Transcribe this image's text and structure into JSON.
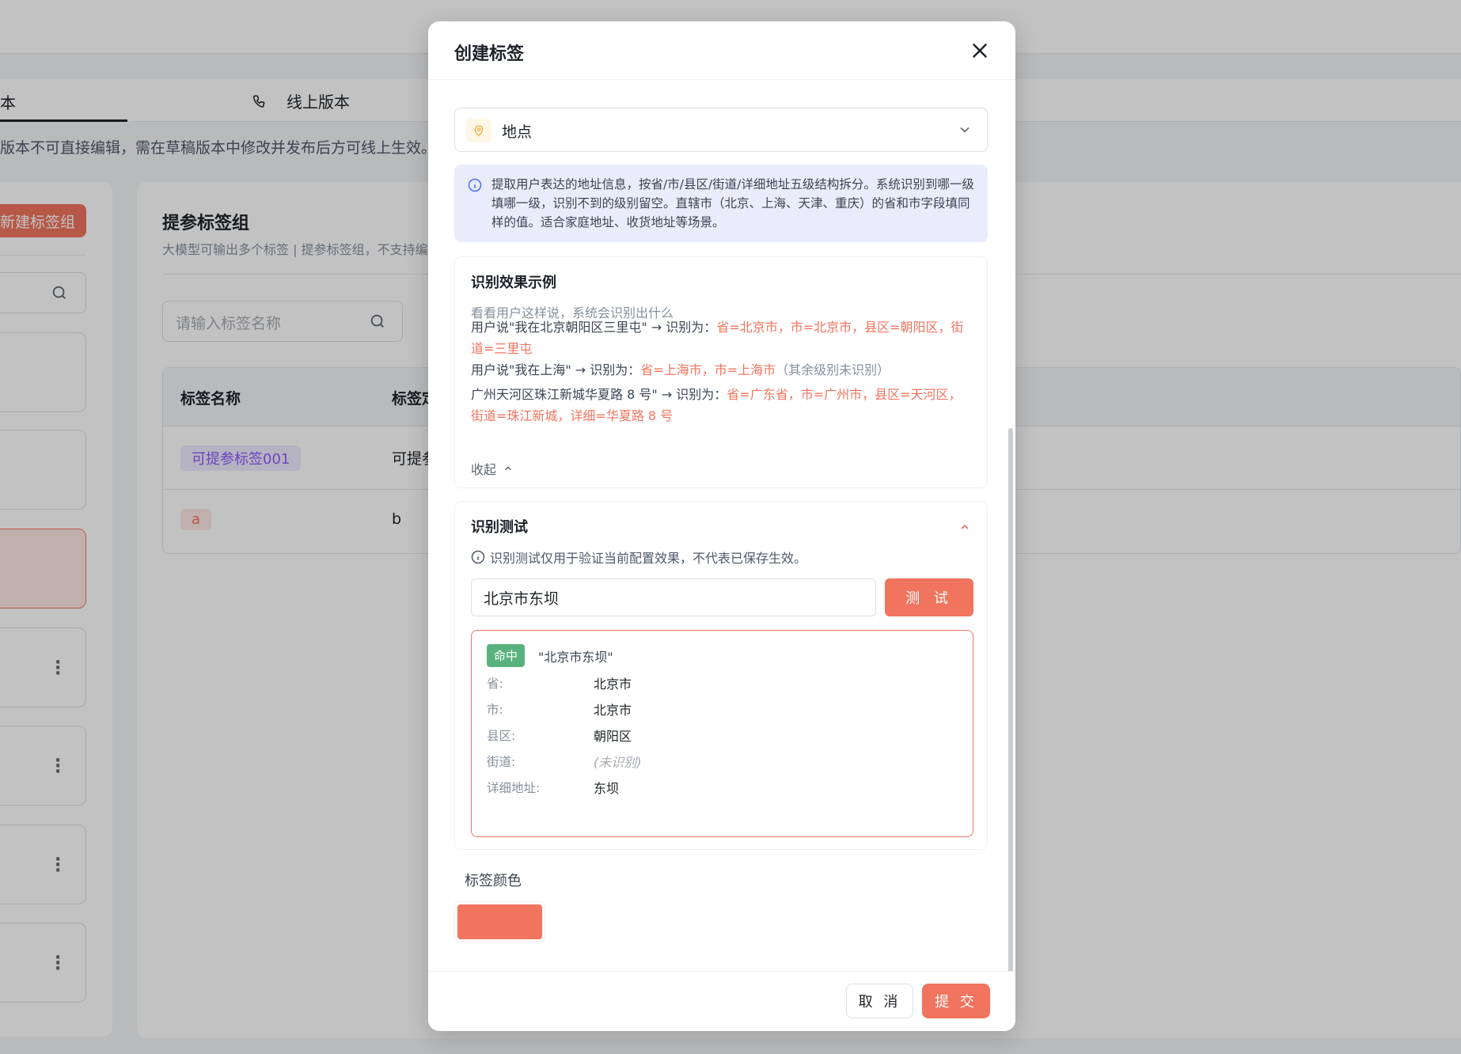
{
  "background": {
    "tabs": {
      "active_partial": "本",
      "online": "线上版本"
    },
    "notice": "版本不可直接编辑，需在草稿版本中修改并发布后方可线上生效。",
    "new_group_button": "新建标签组",
    "group_title": "提参标签组",
    "group_subtitle": "大模型可输出多个标签  |  提参标签组，不支持编",
    "search_placeholder": "请输入标签名称",
    "table": {
      "headers": [
        "标签名称",
        "标签定"
      ],
      "rows": [
        {
          "tag": "可提参标签001",
          "col2": "可提参"
        },
        {
          "tag": "a",
          "col2": "b"
        }
      ]
    }
  },
  "modal": {
    "title": "创建标签",
    "type_select": {
      "value": "地点",
      "icon": "location-pin-icon"
    },
    "info": "提取用户表达的地址信息，按省/市/县区/街道/详细地址五级结构拆分。系统识别到哪一级填哪一级，识别不到的级别留空。直辖市（北京、上海、天津、重庆）的省和市字段填同样的值。适合家庭地址、收货地址等场景。",
    "examples": {
      "title": "识别效果示例",
      "subtitle": "看看用户这样说，系统会识别出什么",
      "items": [
        {
          "said": "用户说\"我在北京朝阳区三里屯\" → 识别为：",
          "result": "省=北京市，市=北京市，县区=朝阳区，街道=三里屯",
          "note": ""
        },
        {
          "said": "用户说\"我在上海\" → 识别为：",
          "result": "省=上海市，市=上海市",
          "note": "（其余级别未识别）"
        },
        {
          "said": "广州天河区珠江新城华夏路 8 号\" → 识别为：",
          "result": "省=广东省，市=广州市，县区=天河区，街道=珠江新城，详细=华夏路 8 号",
          "note": ""
        }
      ],
      "collapse_label": "收起"
    },
    "test": {
      "title": "识别测试",
      "note": "识别测试仅用于验证当前配置效果，不代表已保存生效。",
      "input_value": "北京市东坝",
      "button_label": "测 试",
      "result": {
        "badge": "命中",
        "query": "\"北京市东坝\"",
        "fields": [
          {
            "label": "省:",
            "value": "北京市",
            "empty": false
          },
          {
            "label": "市:",
            "value": "北京市",
            "empty": false
          },
          {
            "label": "县区:",
            "value": "朝阳区",
            "empty": false
          },
          {
            "label": "街道:",
            "value": "(未识别)",
            "empty": true
          },
          {
            "label": "详细地址:",
            "value": "东坝",
            "empty": false
          }
        ]
      }
    },
    "color": {
      "label": "标签颜色",
      "selected": "#f0745e",
      "palette": [
        "#f0745e",
        "#f07d3a",
        "#f0b040",
        "#5ec040",
        "#4a88ec",
        "#6ccb98",
        "#a98af5",
        "#9a52f0",
        "#e05cc4",
        "#5a6a88"
      ]
    },
    "footer": {
      "cancel": "取 消",
      "submit": "提 交"
    }
  }
}
